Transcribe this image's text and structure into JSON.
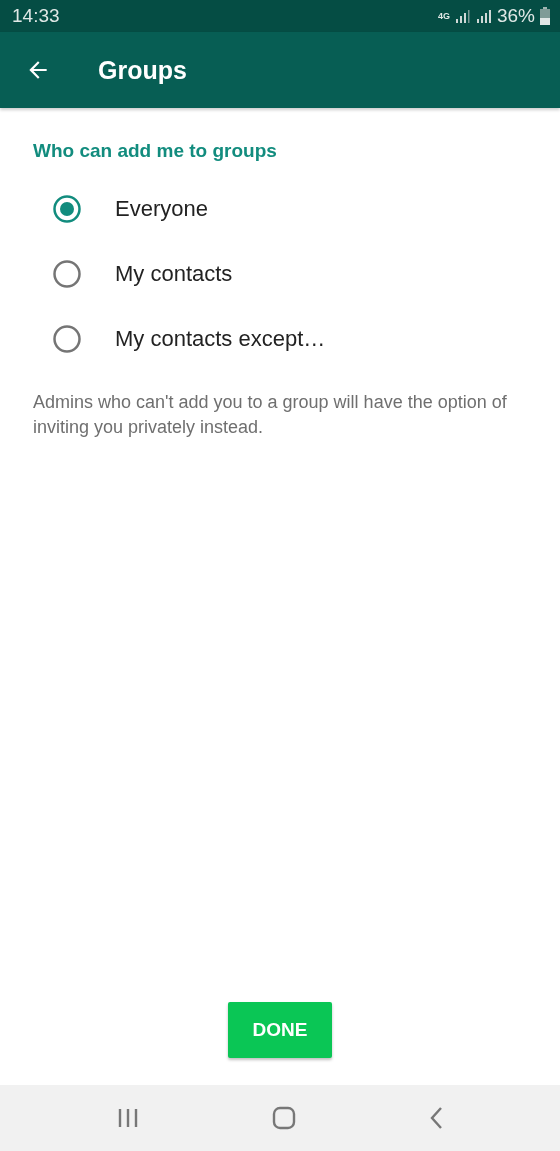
{
  "status_bar": {
    "time": "14:33",
    "network": "4G",
    "battery": "36%"
  },
  "app_bar": {
    "title": "Groups"
  },
  "section": {
    "title": "Who can add me to groups",
    "options": [
      {
        "label": "Everyone",
        "selected": true
      },
      {
        "label": "My contacts",
        "selected": false
      },
      {
        "label": "My contacts except…",
        "selected": false
      }
    ],
    "note": "Admins who can't add you to a group will have the option of inviting you privately instead."
  },
  "done_button": {
    "label": "DONE"
  }
}
